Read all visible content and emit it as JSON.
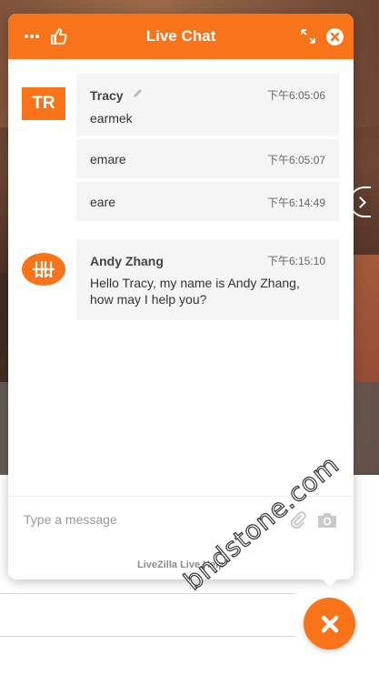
{
  "header": {
    "title": "Live Chat",
    "icons": [
      "menu-dots-icon",
      "thumbs-up-icon",
      "expand-icon",
      "close-circle-icon"
    ]
  },
  "messages": [
    {
      "avatar_text": "TR",
      "name": "Tracy",
      "edit_icon": "pencil-icon",
      "entries": [
        {
          "text": "earmek",
          "time": "下午6:05:06"
        },
        {
          "text": "emare",
          "time": "下午6:05:07"
        },
        {
          "text": "eare",
          "time": "下午6:14:49"
        }
      ]
    },
    {
      "avatar_icon": "operator-logo-icon",
      "name": "Andy Zhang",
      "time": "下午6:15:10",
      "text_line1": "Hello Tracy, my name is Andy Zhang,",
      "text_line2": "how may I help you?"
    }
  ],
  "composer": {
    "placeholder": "Type a message",
    "icons": [
      "paperclip-icon",
      "camera-icon"
    ]
  },
  "footer": {
    "powered_by": "LiveZilla Live Help"
  },
  "fab_icon": "close-icon",
  "watermark": "bndstone.com",
  "colors": {
    "accent": "#f97319",
    "bubble": "#f5f5f5"
  }
}
